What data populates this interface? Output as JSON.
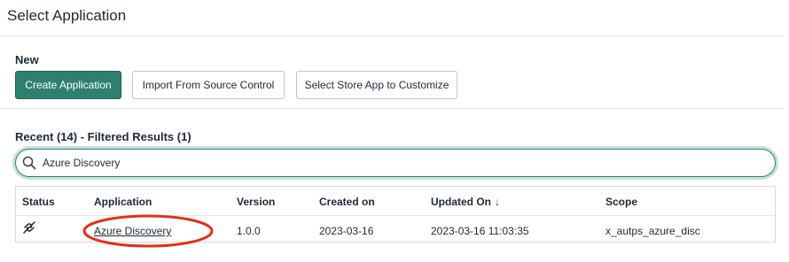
{
  "page": {
    "title": "Select Application"
  },
  "new_section": {
    "label": "New",
    "buttons": {
      "create": "Create Application",
      "import": "Import From Source Control",
      "store": "Select Store App to Customize"
    }
  },
  "recent_section": {
    "label": "Recent (14) - Filtered Results (1)",
    "search": {
      "value": "Azure Discovery",
      "icon": "search-icon"
    },
    "table": {
      "headers": {
        "status": "Status",
        "application": "Application",
        "version": "Version",
        "created_on": "Created on",
        "updated_on": "Updated On",
        "scope": "Scope"
      },
      "sort_indicator": "↓",
      "rows": [
        {
          "status_icon": "unlink-icon",
          "application": "Azure Discovery",
          "version": "1.0.0",
          "created_on": "2023-03-16",
          "updated_on": "2023-03-16 11:03:35",
          "scope": "x_autps_azure_disc"
        }
      ]
    }
  },
  "colors": {
    "primary": "#2e7f6f",
    "annotation": "#e0321b"
  }
}
